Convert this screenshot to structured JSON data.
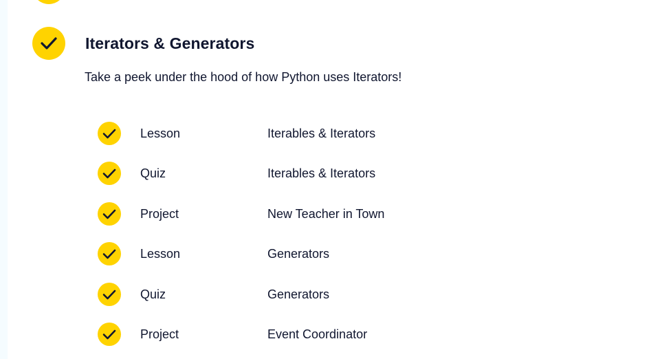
{
  "module": {
    "title": "Iterators & Generators",
    "description": "Take a peek under the hood of how Python uses Iterators!",
    "status_icon": "check-icon",
    "accent_color": "#ffd300",
    "text_color": "#10162f"
  },
  "items": [
    {
      "type": "Lesson",
      "name": "Iterables & Iterators",
      "completed": true
    },
    {
      "type": "Quiz",
      "name": "Iterables & Iterators",
      "completed": true
    },
    {
      "type": "Project",
      "name": "New Teacher in Town",
      "completed": true
    },
    {
      "type": "Lesson",
      "name": "Generators",
      "completed": true
    },
    {
      "type": "Quiz",
      "name": "Generators",
      "completed": true
    },
    {
      "type": "Project",
      "name": "Event Coordinator",
      "completed": true
    }
  ]
}
